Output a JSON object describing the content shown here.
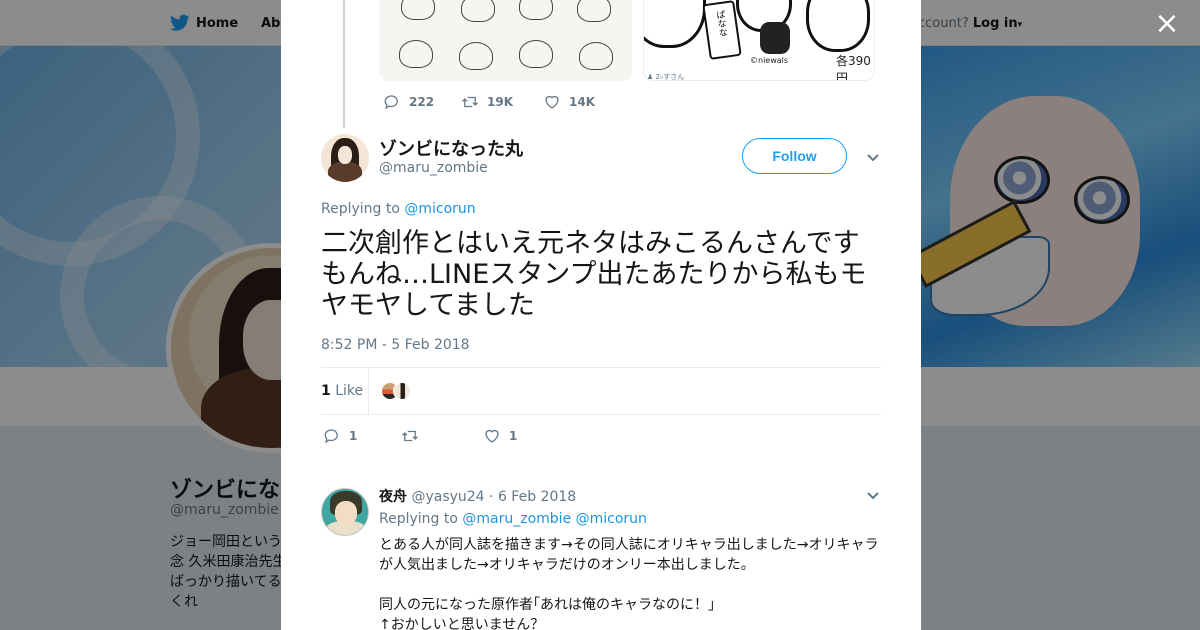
{
  "background": {
    "nav": {
      "home_label": "Home",
      "about_label": "Abo",
      "account_prompt": "ccount?",
      "login_label": "Log in"
    },
    "profile": {
      "name": "ゾンビにな",
      "handle": "@maru_zombie",
      "bio_lines": [
        "ジョー岡田という",
        "念 久米田康治先生",
        "ばっかり描いてる",
        "くれ"
      ]
    },
    "close_label": "×"
  },
  "previous_tweet": {
    "media_credit": "©niewals",
    "media_price": "各390円",
    "media_caption": "♟ 2♭すさん",
    "tag_text": "ぱなな",
    "actions": {
      "replies": "222",
      "retweets": "19K",
      "likes": "14K"
    }
  },
  "tweet": {
    "author_name": "ゾンビになった丸",
    "author_handle": "@maru_zombie",
    "follow_label": "Follow",
    "replying_prefix": "Replying to",
    "replying_mention": "@micorun",
    "text": "二次創作とはいえ元ネタはみこるんさんですもんね…LINEスタンプ出たあたりから私もモヤモヤしてました",
    "timestamp": "8:52 PM - 5 Feb 2018",
    "like_count": "1",
    "like_label": "Like",
    "actions": {
      "replies": "1",
      "retweets": "",
      "likes": "1"
    }
  },
  "reply": {
    "author_name": "夜舟",
    "author_handle": "@yasyu24",
    "date": "6 Feb 2018",
    "replying_prefix": "Replying to",
    "mentions": [
      "@maru_zombie",
      "@micorun"
    ],
    "text": "とある人が同人誌を描きます→その同人誌にオリキャラ出しました→オリキャラが人気出ました→オリキャラだけのオンリー本出しました。\n\n同人の元になった原作者｢あれは俺のキャラなのに！｣\n↑おかしいと思いません？"
  },
  "colors": {
    "link": "#1b95e0",
    "brand": "#1da1f2",
    "text": "#14171a",
    "muted": "#657786"
  }
}
